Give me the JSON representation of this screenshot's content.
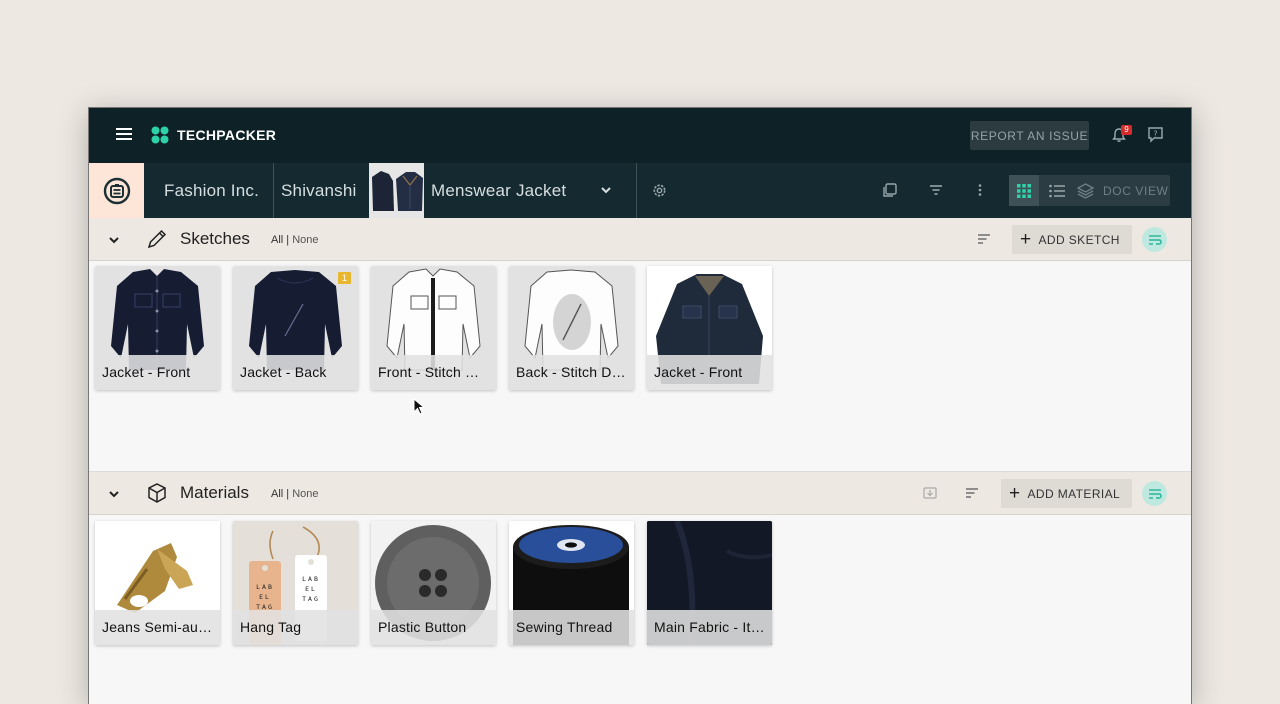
{
  "app": {
    "name": "TECHPACKER"
  },
  "topbar": {
    "report_label": "REPORT AN ISSUE",
    "notification_count": "9"
  },
  "breadcrumb": {
    "company": "Fashion Inc.",
    "user": "Shivanshi",
    "style": "Menswear Jacket"
  },
  "toolbar": {
    "doc_view_label": "DOC VIEW",
    "active_view": "grid"
  },
  "sketches": {
    "title": "Sketches",
    "filter_all": "All |",
    "filter_none": "None",
    "add_label": "ADD SKETCH",
    "items": [
      {
        "label": "Jacket - Front",
        "comment_count": ""
      },
      {
        "label": "Jacket - Back",
        "comment_count": "1"
      },
      {
        "label": "Front - Stitch Details"
      },
      {
        "label": "Back - Stitch Details"
      },
      {
        "label": "Jacket - Front"
      }
    ]
  },
  "materials": {
    "title": "Materials",
    "filter_all": "All |",
    "filter_none": "None",
    "add_label": "ADD MATERIAL",
    "items": [
      {
        "label": "Jeans Semi-auto Zipper Slider"
      },
      {
        "label": "Hang Tag",
        "tag_text": "LAB EL TAG"
      },
      {
        "label": "Plastic Button"
      },
      {
        "label": "Sewing Thread"
      },
      {
        "label": "Main Fabric - Italian Wool"
      }
    ]
  },
  "colors": {
    "topbar": "#0d2127",
    "crumbbar": "#152a30",
    "accent": "#2ed2a8",
    "section_bg": "#ede8e2"
  }
}
